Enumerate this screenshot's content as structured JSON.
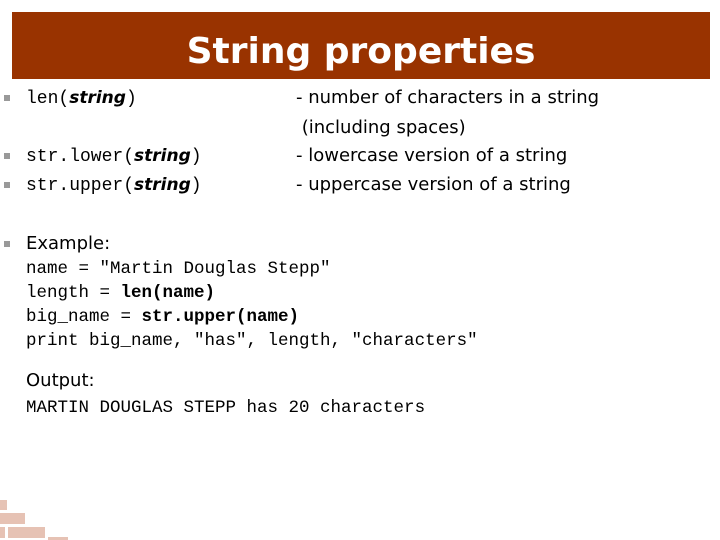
{
  "slide": {
    "title": "String properties",
    "title_bar_color": "#993300"
  },
  "functions": [
    {
      "prefix": "len(",
      "arg": "string",
      "suffix": ")",
      "description": "- number of characters in a string",
      "description_cont": " (including spaces)"
    },
    {
      "prefix": "str.lower(",
      "arg": "string",
      "suffix": ")",
      "description": "- lowercase version of a string"
    },
    {
      "prefix": "str.upper(",
      "arg": "string",
      "suffix": ")",
      "description": "- uppercase version of a string"
    }
  ],
  "example": {
    "label": "Example:",
    "lines": [
      {
        "plain": "name = \"Martin Douglas Stepp\"",
        "bold": ""
      },
      {
        "plain": "length = ",
        "bold": "len(name)"
      },
      {
        "plain": "big_name = ",
        "bold": "str.upper(name)"
      },
      {
        "plain": "print big_name, \"has\", length, \"characters\"",
        "bold": ""
      }
    ]
  },
  "output": {
    "label": "Output:",
    "text": "MARTIN DOUGLAS STEPP has 20 characters"
  }
}
